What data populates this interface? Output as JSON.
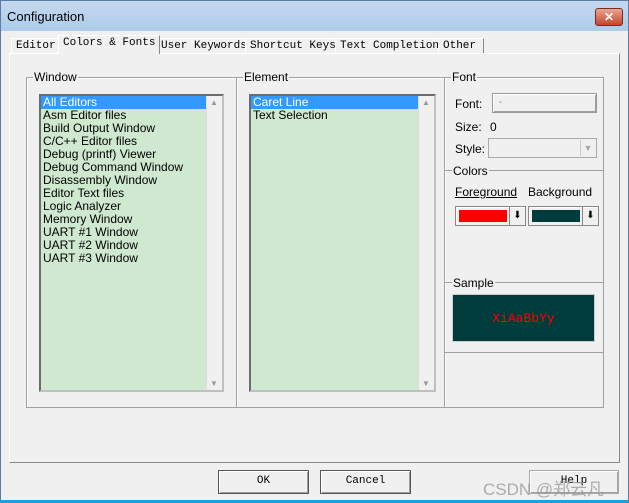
{
  "window": {
    "title": "Configuration"
  },
  "tabs": [
    {
      "label": "Editor"
    },
    {
      "label": "Colors & Fonts",
      "active": true
    },
    {
      "label": "User Keywords"
    },
    {
      "label": "Shortcut Keys"
    },
    {
      "label": "Text Completion"
    },
    {
      "label": "Other"
    }
  ],
  "window_group": {
    "label": "Window",
    "items": [
      "All Editors",
      "Asm Editor files",
      "Build Output Window",
      "C/C++ Editor files",
      "Debug (printf) Viewer",
      "Debug Command Window",
      "Disassembly Window",
      "Editor Text files",
      "Logic Analyzer",
      "Memory Window",
      "UART #1 Window",
      "UART #2 Window",
      "UART #3 Window"
    ],
    "selected": "All Editors"
  },
  "element_group": {
    "label": "Element",
    "items": [
      "Caret Line",
      "Text Selection"
    ],
    "selected": "Caret Line"
  },
  "font_group": {
    "label": "Font",
    "font_label": "Font:",
    "font_value": "-",
    "size_label": "Size:",
    "size_value": "0",
    "style_label": "Style:",
    "style_value": ""
  },
  "colors_group": {
    "label": "Colors",
    "foreground_label": "Foreground",
    "background_label": "Background",
    "foreground_color": "#ff0000",
    "background_color": "#003c3c"
  },
  "sample_group": {
    "label": "Sample",
    "text": "XiAaBbYy"
  },
  "buttons": {
    "ok": "OK",
    "cancel": "Cancel",
    "help": "Help"
  },
  "watermark": "CSDN @郑云凡"
}
